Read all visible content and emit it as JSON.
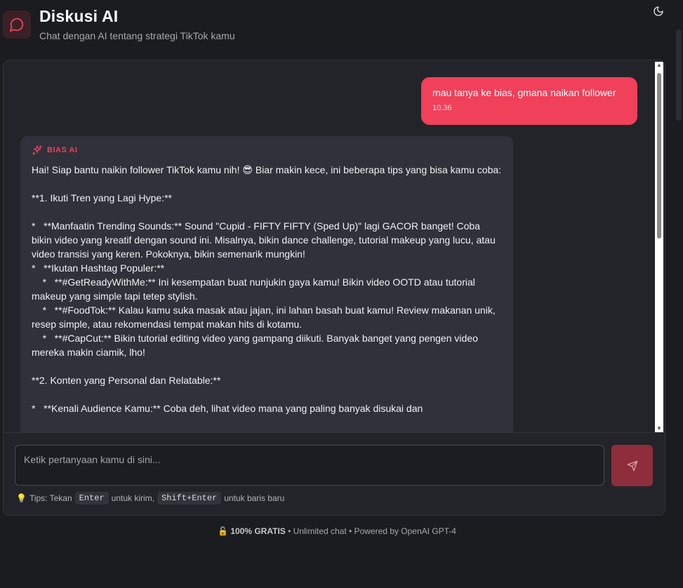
{
  "header": {
    "title": "Diskusi AI",
    "subtitle": "Chat dengan AI tentang strategi TikTok kamu",
    "icons": {
      "app": "chat-bubble-icon",
      "theme": "moon-icon"
    }
  },
  "messages": {
    "user": {
      "text": "mau tanya ke bias, gmana naikan follower",
      "time": "10.36"
    },
    "ai": {
      "label": "BIAS AI",
      "icon": "sparkles-icon",
      "text": "Hai! Siap bantu naikin follower TikTok kamu nih! 😎 Biar makin kece, ini beberapa tips yang bisa kamu coba:\n\n**1. Ikuti Tren yang Lagi Hype:**\n\n*   **Manfaatin Trending Sounds:** Sound \"Cupid - FIFTY FIFTY (Sped Up)\" lagi GACOR banget! Coba bikin video yang kreatif dengan sound ini. Misalnya, bikin dance challenge, tutorial makeup yang lucu, atau video transisi yang keren. Pokoknya, bikin semenarik mungkin!\n*   **Ikutan Hashtag Populer:**\n    *   **#GetReadyWithMe:** Ini kesempatan buat nunjukin gaya kamu! Bikin video OOTD atau tutorial makeup yang simple tapi tetep stylish.\n    *   **#FoodTok:** Kalau kamu suka masak atau jajan, ini lahan basah buat kamu! Review makanan unik, resep simple, atau rekomendasi tempat makan hits di kotamu.\n    *   **#CapCut:** Bikin tutorial editing video yang gampang diikuti. Banyak banget yang pengen video mereka makin ciamik, lho!\n\n**2. Konten yang Personal dan Relatable:**\n\n*   **Kenali Audience Kamu:** Coba deh, lihat video mana yang paling banyak disukai dan"
    }
  },
  "input": {
    "placeholder": "Ketik pertanyaan kamu di sini...",
    "tips": {
      "prefix": "Tips: Tekan",
      "key1": "Enter",
      "mid": "untuk kirim,",
      "key2": "Shift+Enter",
      "suffix": "untuk baris baru"
    }
  },
  "footer": {
    "bold": "100% GRATIS",
    "rest": "• Unlimited chat • Powered by OpenAI GPT-4"
  },
  "colors": {
    "accent": "#f0405a",
    "background": "#1b1c20",
    "card": "#232429",
    "ai_bubble": "#30313a"
  }
}
